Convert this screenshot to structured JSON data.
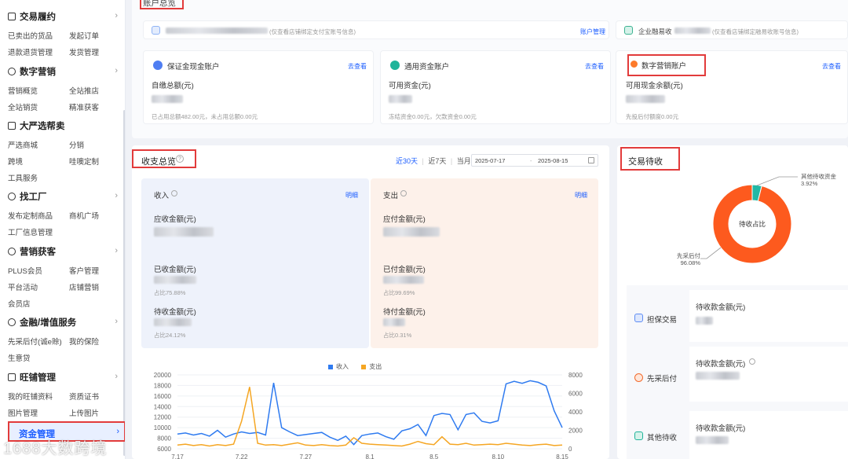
{
  "sidebar": {
    "groups": [
      {
        "title": "交易履约",
        "items": [
          "已卖出的货品",
          "发起订单",
          "退款退货管理",
          "发货管理"
        ]
      },
      {
        "title": "数字营销",
        "items": [
          "营销概览",
          "全站推店",
          "全站销货",
          "精准获客"
        ]
      },
      {
        "title": "大严选帮卖",
        "items": [
          "严选商城",
          "分销",
          "跨境",
          "哇噢定制",
          "工具服务"
        ]
      },
      {
        "title": "找工厂",
        "items": [
          "发布定制商品",
          "商机广场",
          "工厂信息管理"
        ]
      },
      {
        "title": "营销获客",
        "items": [
          "PLUS会员",
          "客户管理",
          "平台活动",
          "店铺营销",
          "会员店"
        ]
      },
      {
        "title": "金融/增值服务",
        "items": [
          "先采后付(诚e赊)",
          "我的保险",
          "生意贷"
        ]
      },
      {
        "title": "旺铺管理",
        "items": [
          "我的旺铺资料",
          "资质证书",
          "图片管理",
          "上传图片"
        ]
      }
    ],
    "active": "资金管理",
    "watermark": "1688大数跨境"
  },
  "account": {
    "section_title": "账户总览",
    "alipay_hint": "(仅查看店铺绑定支付宝账号信息)",
    "account_manage": "账户管理",
    "enterprise_label": "企业融易收",
    "enterprise_hint": "(仅查看店铺绑定融易收账号信息)",
    "cards": [
      {
        "title": "保证金现金账户",
        "link": "去查看",
        "sub": "自缴总额(元)",
        "foot": "已占用总额482.00元，未占用总额0.00元"
      },
      {
        "title": "通用资金账户",
        "link": "去查看",
        "sub": "可用资金(元)",
        "foot": "冻结资金0.00元，欠款资金0.00元"
      },
      {
        "title": "数字营销账户",
        "link": "去查看",
        "sub": "可用现金余额(元)",
        "foot": "先投后付额度0.00元"
      }
    ]
  },
  "overview": {
    "title": "收支总览",
    "tabs": [
      "近30天",
      "近7天",
      "当月"
    ],
    "date_start": "2025-07-17",
    "date_sep": "-",
    "date_end": "2025-08-15",
    "income": {
      "title": "收入",
      "detail": "明细",
      "receivable_label": "应收金额(元)",
      "received_label": "已收金额(元)",
      "received_ratio": "占比75.88%",
      "pending_label": "待收金额(元)",
      "pending_ratio": "占比24.12%"
    },
    "expense": {
      "title": "支出",
      "detail": "明细",
      "payable_label": "应付金额(元)",
      "paid_label": "已付金额(元)",
      "paid_ratio": "占比99.69%",
      "pending_label": "待付金额(元)",
      "pending_ratio": "占比0.31%"
    }
  },
  "pending": {
    "title": "交易待收",
    "donut_center": "待收占比",
    "other_label": "其他待收资金",
    "other_pct": "3.92%",
    "bnpl_label": "先采后付",
    "bnpl_pct": "96.08%",
    "rows": [
      {
        "name": "担保交易",
        "label": "待收款金额(元)"
      },
      {
        "name": "先采后付",
        "label": "待收款金额(元)"
      },
      {
        "name": "其他待收",
        "label": "待收款金额(元)"
      }
    ]
  },
  "colors": {
    "income": "#2f7bf0",
    "expense": "#f5a623",
    "donut_main": "#fd5a1e",
    "donut_other": "#22b8a5",
    "highlight": "#e23b3b",
    "accent": "#1a5cff"
  },
  "chart_data": {
    "type": "line",
    "legend": [
      "收入",
      "支出"
    ],
    "x_ticks": [
      "7.17",
      "7.22",
      "7.27",
      "8.1",
      "8.5",
      "8.10",
      "8.15"
    ],
    "y_left_ticks": [
      "20000",
      "18000",
      "16000",
      "14000",
      "12000",
      "10000",
      "8000",
      "6000"
    ],
    "y_right_ticks": [
      "8000",
      "6000",
      "4000",
      "2000",
      "0"
    ],
    "ylim_left": [
      6000,
      20000
    ],
    "ylim_right": [
      0,
      8000
    ],
    "series": [
      {
        "name": "收入",
        "axis": "left",
        "values": [
          8800,
          9000,
          8600,
          8900,
          8400,
          9500,
          8200,
          8800,
          9200,
          8900,
          9100,
          8600,
          18500,
          10000,
          9200,
          8500,
          8700,
          8900,
          9100,
          8200,
          7600,
          8400,
          6800,
          8500,
          8800,
          9000,
          8300,
          7800,
          9400,
          9800,
          10600,
          8500,
          12300,
          12700,
          12500,
          9600,
          12500,
          12800,
          11200,
          10900,
          11300,
          18300,
          18800,
          18400,
          18900,
          18600,
          17900,
          13200,
          10000
        ]
      },
      {
        "name": "支出",
        "axis": "right",
        "values": [
          400,
          500,
          350,
          450,
          300,
          450,
          350,
          500,
          3000,
          6700,
          600,
          400,
          450,
          350,
          500,
          650,
          400,
          350,
          450,
          350,
          300,
          400,
          1200,
          600,
          500,
          450,
          400,
          350,
          300,
          500,
          800,
          550,
          450,
          1300,
          500,
          450,
          600,
          400,
          450,
          500,
          450,
          600,
          500,
          400,
          350,
          450,
          500,
          350,
          400
        ]
      }
    ]
  }
}
